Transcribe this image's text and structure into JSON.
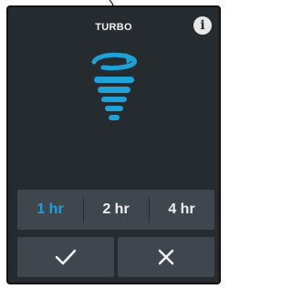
{
  "header": {
    "title": "TURBO",
    "info_icon": "info-icon",
    "info_glyph": "i"
  },
  "mode_icon": "tornado-icon",
  "accent_color": "#1ea2d8",
  "duration": {
    "options": [
      "1 hr",
      "2 hr",
      "4 hr"
    ],
    "selected": "1 hr"
  },
  "actions": {
    "confirm_icon": "checkmark-icon",
    "cancel_icon": "close-icon"
  }
}
